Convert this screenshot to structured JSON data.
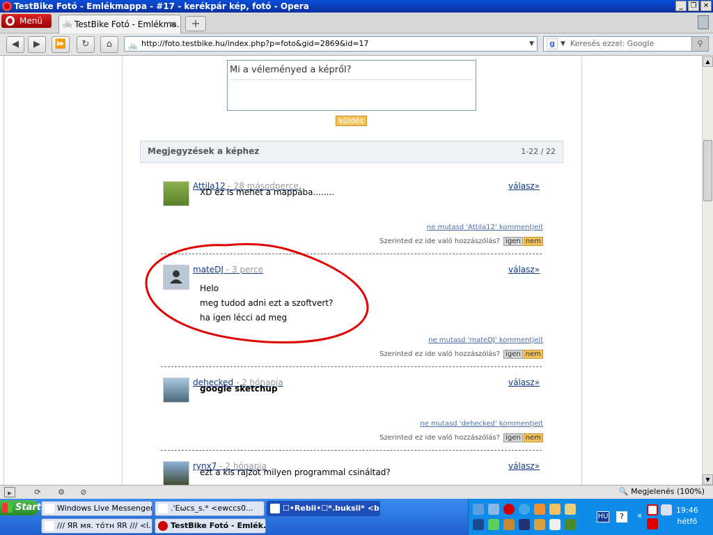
{
  "window": {
    "title": "TestBike Fotó - Emlékmappa - #17 - kerékpár kép, fotó - Opera"
  },
  "tabs": {
    "menu_label": "Menü",
    "active_tab": "TestBike Fotó - Emlékma...",
    "new_tab": "+"
  },
  "nav": {
    "url": "http://foto.testbike.hu/index.php?p=foto&gid=2869&id=17",
    "search_placeholder": "Keresés ezzel: Google"
  },
  "form": {
    "comment_placeholder": "Mi a véleményed a képről?",
    "send_label": "küldés"
  },
  "comments_section": {
    "title": "Megjegyzések a képhez",
    "count": "1-22 / 22"
  },
  "comments": [
    {
      "user": "Attila12",
      "time": "- 28 másodperce",
      "reply": "válasz»",
      "lines": [
        "XD ez is mehet a mappába........"
      ],
      "hide": "ne mutasd 'Attila12' kommentjeit",
      "question": "Szerinted ez ide való hozzászólás?",
      "yes": "igen",
      "no": "nem"
    },
    {
      "user": "mateDJ",
      "time": "- 3 perce",
      "reply": "válasz»",
      "lines": [
        "Helo",
        "meg tudod adni ezt a szoftvert?",
        "ha igen lécci ad meg"
      ],
      "hide": "ne mutasd 'mateDJ' kommentjeit",
      "question": "Szerinted ez ide való hozzászólás?",
      "yes": "igen",
      "no": "nem"
    },
    {
      "user": "dehecked",
      "time": "- 2 hónapja",
      "reply": "válasz»",
      "lines": [
        "google sketchup"
      ],
      "hide": "ne mutasd 'dehecked' kommentjeit",
      "question": "Szerinted ez ide való hozzászólás?",
      "yes": "igen",
      "no": "nem"
    },
    {
      "user": "rynx7",
      "time": "- 2 hónapja",
      "reply": "válasz»",
      "lines": [
        "ezt a kis rajzot milyen programmal csináltad?"
      ]
    }
  ],
  "statusbar": {
    "zoom": "Megjelenés (100%)"
  },
  "taskbar": {
    "start": "Start",
    "tasks": [
      "Windows Live Messenger",
      ".'Εωcs_s.*      <ewccs0...",
      "☐•Rebii•☐*.buksii* <ba...",
      "/// ЯR мя. тóтн ЯR /// <l...",
      "TestBike Fotó - Emlék..."
    ],
    "lang": "HU",
    "help": "?",
    "time": "19:46",
    "day": "hétfő"
  },
  "colors": {
    "annotation_circle": "#e00000",
    "link": "#113a82",
    "button_orange": "#f6c35a"
  }
}
